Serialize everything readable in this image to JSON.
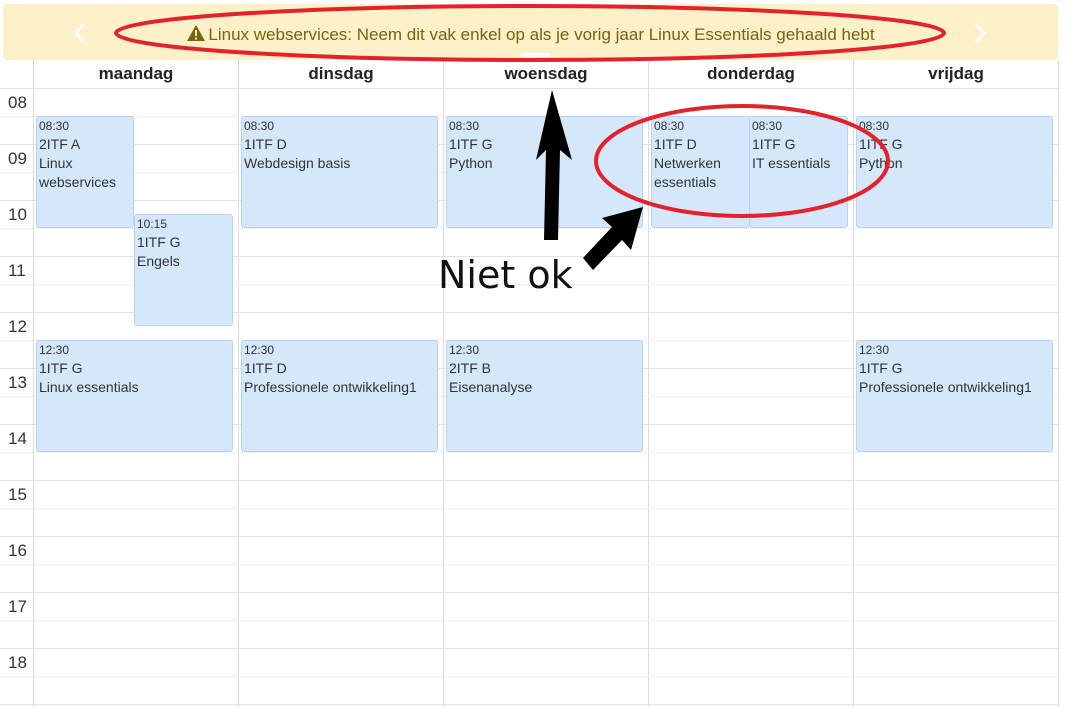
{
  "banner": {
    "message": "Linux webservices: Neem dit vak enkel op als je vorig jaar Linux Essentials gehaald hebt",
    "icons": [
      "warning-icon",
      "chevron-left-icon",
      "chevron-right-icon"
    ],
    "color": "#fcf1c9",
    "text_color": "#7a6210"
  },
  "days": [
    "maandag",
    "dinsdag",
    "woensdag",
    "donderdag",
    "vrijdag"
  ],
  "hours": [
    "08",
    "09",
    "10",
    "11",
    "12",
    "13",
    "14",
    "15",
    "16",
    "17",
    "18"
  ],
  "events": [
    {
      "time": "08:30",
      "group": "2ITF A",
      "course": [
        "Linux",
        "webservices"
      ]
    },
    {
      "time": "10:15",
      "group": "1ITF G",
      "course": [
        "Engels"
      ]
    },
    {
      "time": "12:30",
      "group": "1ITF G",
      "course": [
        "Linux essentials"
      ]
    },
    {
      "time": "08:30",
      "group": "1ITF D",
      "course": [
        "Webdesign basis"
      ]
    },
    {
      "time": "12:30",
      "group": "1ITF D",
      "course": [
        "Professionele ontwikkeling1"
      ]
    },
    {
      "time": "08:30",
      "group": "1ITF G",
      "course": [
        "Python"
      ]
    },
    {
      "time": "12:30",
      "group": "2ITF B",
      "course": [
        "Eisenanalyse"
      ]
    },
    {
      "time": "08:30",
      "group": "1ITF D",
      "course": [
        "Netwerken",
        "essentials"
      ]
    },
    {
      "time": "08:30",
      "group": "1ITF G",
      "course": [
        "IT essentials"
      ]
    },
    {
      "time": "08:30",
      "group": "1ITF G",
      "course": [
        "Python"
      ]
    },
    {
      "time": "12:30",
      "group": "1ITF G",
      "course": [
        "Professionele ontwikkeling1"
      ]
    }
  ],
  "annotation": {
    "label": "Niet ok",
    "color": "#e3222b"
  },
  "colors": {
    "event_fill": "#d5e8fb",
    "event_border": "#b8d3ef"
  }
}
